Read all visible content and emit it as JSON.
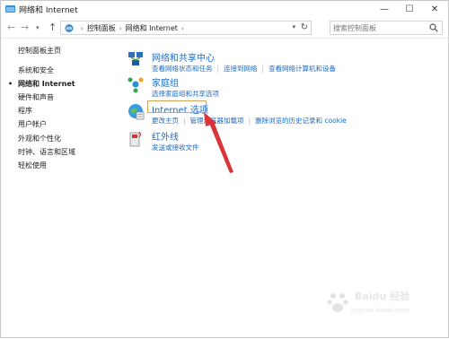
{
  "window": {
    "title": "网络和 Internet",
    "controls": {
      "minimize": "—",
      "maximize": "☐",
      "close": "✕"
    }
  },
  "nav": {
    "back": "←",
    "forward": "→",
    "history": "▾",
    "up": "↑",
    "breadcrumb": [
      "控制面板",
      "网络和 Internet"
    ],
    "search_placeholder": "搜索控制面板"
  },
  "sidebar": {
    "items": [
      {
        "label": "控制面板主页",
        "active": false
      },
      {
        "label": "系统和安全",
        "active": false
      },
      {
        "label": "网络和 Internet",
        "active": true
      },
      {
        "label": "硬件和声音",
        "active": false
      },
      {
        "label": "程序",
        "active": false
      },
      {
        "label": "用户帐户",
        "active": false
      },
      {
        "label": "外观和个性化",
        "active": false
      },
      {
        "label": "时钟、语言和区域",
        "active": false
      },
      {
        "label": "轻松使用",
        "active": false
      }
    ]
  },
  "categories": [
    {
      "title": "网络和共享中心",
      "icon": "network-sharing-icon",
      "links": [
        "查看网络状态和任务",
        "连接到网络",
        "查看网络计算机和设备"
      ]
    },
    {
      "title": "家庭组",
      "icon": "homegroup-icon",
      "links": [
        "选择家庭组和共享选项"
      ]
    },
    {
      "title": "Internet 选项",
      "icon": "internet-options-icon",
      "links": [
        "更改主页",
        "管理浏览器加载项",
        "删除浏览的历史记录和 cookie"
      ]
    },
    {
      "title": "红外线",
      "icon": "infrared-icon",
      "links": [
        "发送或接收文件"
      ]
    }
  ],
  "colors": {
    "link": "#1a6bc8",
    "annotation": "#d9343a",
    "highlight_border": "#d6a35a"
  },
  "watermark": {
    "text": "Baidu 经验",
    "sub": "jingyan.baidu.com"
  }
}
